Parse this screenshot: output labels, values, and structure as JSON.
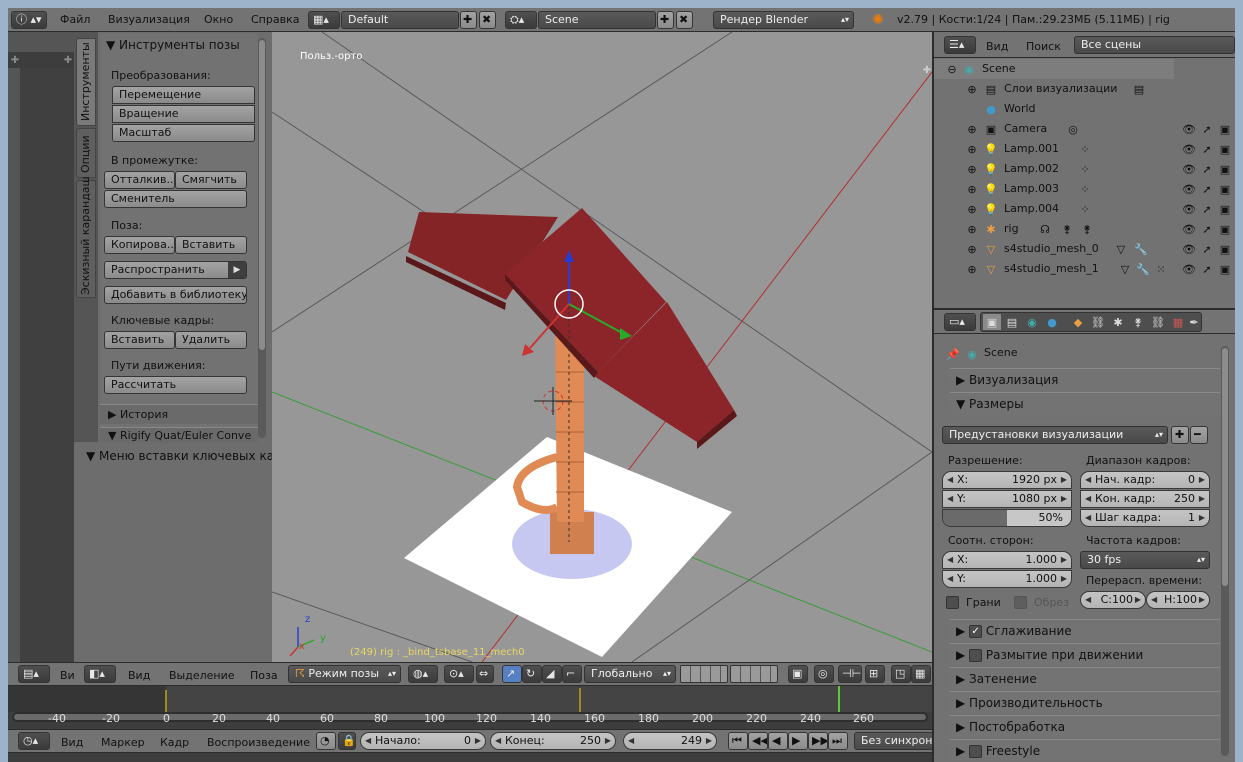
{
  "topbar": {
    "menus": [
      "Файл",
      "Визуализация",
      "Окно",
      "Справка"
    ],
    "layout": "Default",
    "scene": "Scene",
    "engine": "Рендер Blender",
    "info": "v2.79 | Кости:1/24 | Пам.:29.23МБ (5.11МБ) | rig"
  },
  "toolshelf": {
    "tabs": [
      "Инструменты",
      "Опции",
      "Эскизный карандаш"
    ],
    "panel_title": "Инструменты позы",
    "transform_label": "Преобразования:",
    "move": "Перемещение",
    "rotate": "Вращение",
    "scale": "Масштаб",
    "inbetween_label": "В промежутке:",
    "push": "Отталкив...",
    "relax": "Смягчить",
    "breakdowner": "Сменитель",
    "pose_label": "Поза:",
    "copy": "Копирова...",
    "paste": "Вставить",
    "propagate": "Распространить",
    "add_to_library": "Добавить в библиотеку",
    "keyframes_label": "Ключевые кадры:",
    "insert": "Вставить",
    "delete": "Удалить",
    "motion_paths_label": "Пути движения:",
    "calculate": "Рассчитать",
    "history": "История",
    "rigify": "Rigify Quat/Euler Conve",
    "keyframe_menu": "Меню вставки ключевых кад"
  },
  "viewport": {
    "view_label": "Польз.-орто",
    "status": "(249) rig : _bind_tsbase_11_mech0",
    "axes": {
      "x": "x",
      "y": "y",
      "z": "z"
    }
  },
  "viewport_header": {
    "view": "Вид",
    "select": "Выделение",
    "pose": "Поза",
    "mode": "Режим позы",
    "orientation": "Глобально"
  },
  "outliner": {
    "view": "Вид",
    "search": "Поиск",
    "filter": "Все сцены",
    "rows": [
      {
        "name": "Scene",
        "depth": 0,
        "icon": "scene"
      },
      {
        "name": "Слои визуализации",
        "depth": 1,
        "icon": "layers"
      },
      {
        "name": "World",
        "depth": 1,
        "icon": "world"
      },
      {
        "name": "Camera",
        "depth": 1,
        "icon": "camera"
      },
      {
        "name": "Lamp.001",
        "depth": 1,
        "icon": "lamp"
      },
      {
        "name": "Lamp.002",
        "depth": 1,
        "icon": "lamp"
      },
      {
        "name": "Lamp.003",
        "depth": 1,
        "icon": "lamp"
      },
      {
        "name": "Lamp.004",
        "depth": 1,
        "icon": "lamp"
      },
      {
        "name": "rig",
        "depth": 1,
        "icon": "armature"
      },
      {
        "name": "s4studio_mesh_0",
        "depth": 1,
        "icon": "mesh"
      },
      {
        "name": "s4studio_mesh_1",
        "depth": 1,
        "icon": "mesh"
      }
    ]
  },
  "properties": {
    "context": "Scene",
    "render": "Визуализация",
    "dimensions": "Размеры",
    "presets": "Предустановки визуализации",
    "resolution_label": "Разрешение:",
    "res_x_label": "X:",
    "res_x": "1920 px",
    "res_y_label": "Y:",
    "res_y": "1080 px",
    "res_pct": "50%",
    "res_pct_value": 0.5,
    "frame_range_label": "Диапазон кадров:",
    "start_label": "Нач. кадр:",
    "start": "0",
    "end_label": "Кон. кадр:",
    "end": "250",
    "step_label": "Шаг кадра:",
    "step": "1",
    "aspect_label": "Соотн. сторон:",
    "asp_x_label": "X:",
    "asp_x": "1.000",
    "asp_y_label": "Y:",
    "asp_y": "1.000",
    "framerate_label": "Частота кадров:",
    "fps": "30 fps",
    "remap_label": "Перерасп. времени:",
    "remap_old": "С:100",
    "remap_new": "Н:100",
    "border": "Грани",
    "crop": "Обрез",
    "antialias": "Сглаживание",
    "motion_blur": "Размытие при движении",
    "shading": "Затенение",
    "performance": "Производительность",
    "postprocessing": "Постобработка",
    "freestyle": "Freestyle"
  },
  "timeline": {
    "ticks": [
      "-40",
      "-20",
      "0",
      "20",
      "40",
      "60",
      "80",
      "100",
      "120",
      "140",
      "160",
      "180",
      "200",
      "220",
      "240",
      "260"
    ],
    "current_frame_marker": 250,
    "view": "Вид",
    "marker": "Маркер",
    "frame": "Кадр",
    "playback": "Воспроизведение",
    "start_label": "Начало:",
    "start": "0",
    "end_label": "Конец:",
    "end": "250",
    "current": "249",
    "sync": "Без синхрони"
  },
  "left_header": {
    "view": "Ви"
  }
}
